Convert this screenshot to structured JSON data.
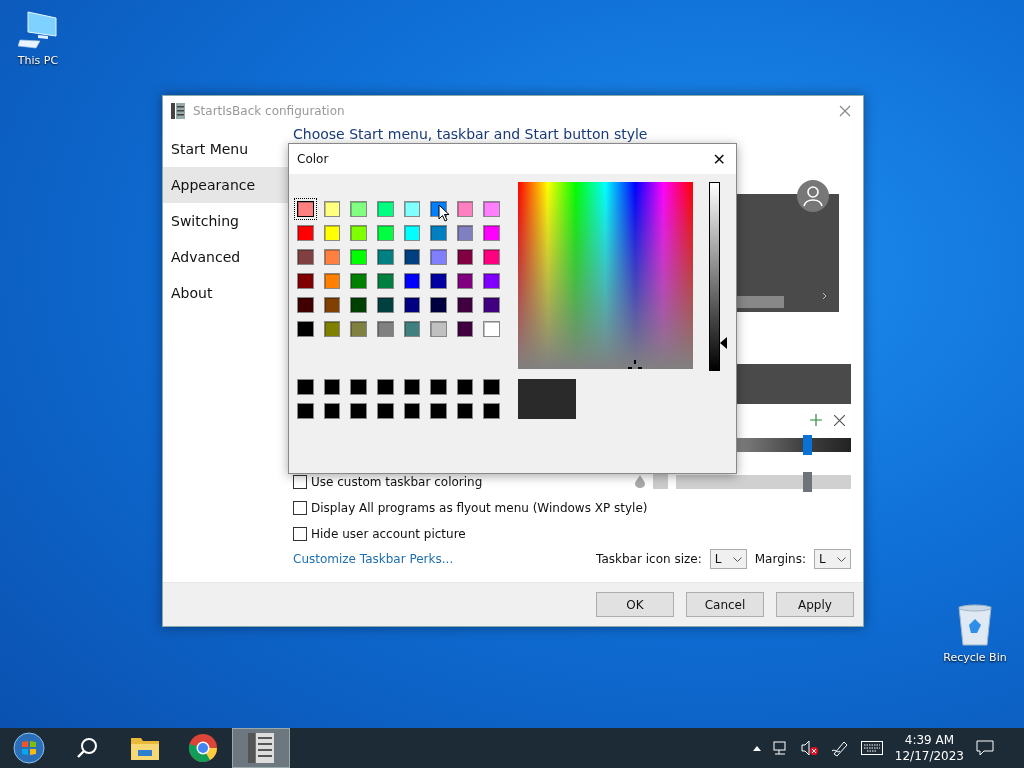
{
  "desktop_icons": [
    {
      "label": "This PC",
      "kind": "computer"
    },
    {
      "label": "Recycle Bin",
      "kind": "recycle"
    }
  ],
  "window": {
    "title": "StartIsBack configuration",
    "sidebar": [
      {
        "label": "Start Menu",
        "selected": false
      },
      {
        "label": "Appearance",
        "selected": true
      },
      {
        "label": "Switching",
        "selected": false
      },
      {
        "label": "Advanced",
        "selected": false
      },
      {
        "label": "About",
        "selected": false
      }
    ],
    "heading": "Choose Start menu, taskbar and Start button style",
    "sliders": [
      {
        "kind": "gradient",
        "level": 0.75
      },
      {
        "kind": "plain",
        "level": 0.75
      }
    ],
    "checkboxes": [
      {
        "label": "Use custom taskbar coloring",
        "checked": false
      },
      {
        "label": "Display All programs as flyout menu (Windows XP style)",
        "checked": false
      },
      {
        "label": "Hide user account picture",
        "checked": false
      }
    ],
    "link": "Customize Taskbar Perks...",
    "dropdowns": [
      {
        "label": "Taskbar icon size:",
        "value": "L"
      },
      {
        "label": "Margins:",
        "value": "L"
      }
    ],
    "buttons": [
      "OK",
      "Cancel",
      "Apply"
    ]
  },
  "color_dialog": {
    "title": "Color",
    "close": "✕",
    "basic_colors": [
      {
        "color": "#ff8080",
        "selected": true
      },
      {
        "color": "#ffff80",
        "selected": false
      },
      {
        "color": "#80ff80",
        "selected": false
      },
      {
        "color": "#00ff80",
        "selected": false
      },
      {
        "color": "#80ffff",
        "selected": false
      },
      {
        "color": "#0080ff",
        "selected": false
      },
      {
        "color": "#ff80c0",
        "selected": false
      },
      {
        "color": "#ff80ff",
        "selected": false
      },
      {
        "color": "#ff0000",
        "selected": false
      },
      {
        "color": "#ffff00",
        "selected": false
      },
      {
        "color": "#80ff00",
        "selected": false
      },
      {
        "color": "#00ff40",
        "selected": false
      },
      {
        "color": "#00ffff",
        "selected": false
      },
      {
        "color": "#0080c0",
        "selected": false
      },
      {
        "color": "#8080c0",
        "selected": false
      },
      {
        "color": "#ff00ff",
        "selected": false
      },
      {
        "color": "#804040",
        "selected": false
      },
      {
        "color": "#ff8040",
        "selected": false
      },
      {
        "color": "#00ff00",
        "selected": false
      },
      {
        "color": "#008080",
        "selected": false
      },
      {
        "color": "#004080",
        "selected": false
      },
      {
        "color": "#8080ff",
        "selected": false
      },
      {
        "color": "#800040",
        "selected": false
      },
      {
        "color": "#ff0080",
        "selected": false
      },
      {
        "color": "#800000",
        "selected": false
      },
      {
        "color": "#ff8000",
        "selected": false
      },
      {
        "color": "#008000",
        "selected": false
      },
      {
        "color": "#008040",
        "selected": false
      },
      {
        "color": "#0000ff",
        "selected": false
      },
      {
        "color": "#0000a0",
        "selected": false
      },
      {
        "color": "#800080",
        "selected": false
      },
      {
        "color": "#8000ff",
        "selected": false
      },
      {
        "color": "#400000",
        "selected": false
      },
      {
        "color": "#804000",
        "selected": false
      },
      {
        "color": "#004000",
        "selected": false
      },
      {
        "color": "#004040",
        "selected": false
      },
      {
        "color": "#000080",
        "selected": false
      },
      {
        "color": "#000040",
        "selected": false
      },
      {
        "color": "#400040",
        "selected": false
      },
      {
        "color": "#400080",
        "selected": false
      },
      {
        "color": "#000000",
        "selected": false
      },
      {
        "color": "#808000",
        "selected": false
      },
      {
        "color": "#808040",
        "selected": false
      },
      {
        "color": "#808080",
        "selected": false
      },
      {
        "color": "#408080",
        "selected": false
      },
      {
        "color": "#c0c0c0",
        "selected": false
      },
      {
        "color": "#400040",
        "selected": false
      },
      {
        "color": "#ffffff",
        "selected": false
      }
    ],
    "custom_colors": [
      {
        "color": "#000000"
      },
      {
        "color": "#000000"
      },
      {
        "color": "#000000"
      },
      {
        "color": "#000000"
      },
      {
        "color": "#000000"
      },
      {
        "color": "#000000"
      },
      {
        "color": "#000000"
      },
      {
        "color": "#000000"
      },
      {
        "color": "#000000"
      },
      {
        "color": "#000000"
      },
      {
        "color": "#000000"
      },
      {
        "color": "#000000"
      },
      {
        "color": "#000000"
      },
      {
        "color": "#000000"
      },
      {
        "color": "#000000"
      },
      {
        "color": "#000000"
      }
    ],
    "luminosity": {
      "level": 0.85
    },
    "preview": {
      "color": "#2a2a2a"
    }
  },
  "taskbar": {
    "apps": [
      {
        "kind": "start",
        "active": false
      },
      {
        "kind": "search",
        "active": false
      },
      {
        "kind": "folder",
        "active": false
      },
      {
        "kind": "browser",
        "active": false
      },
      {
        "kind": "config",
        "active": true
      }
    ],
    "time": "4:39 AM",
    "date": "12/17/2023"
  }
}
